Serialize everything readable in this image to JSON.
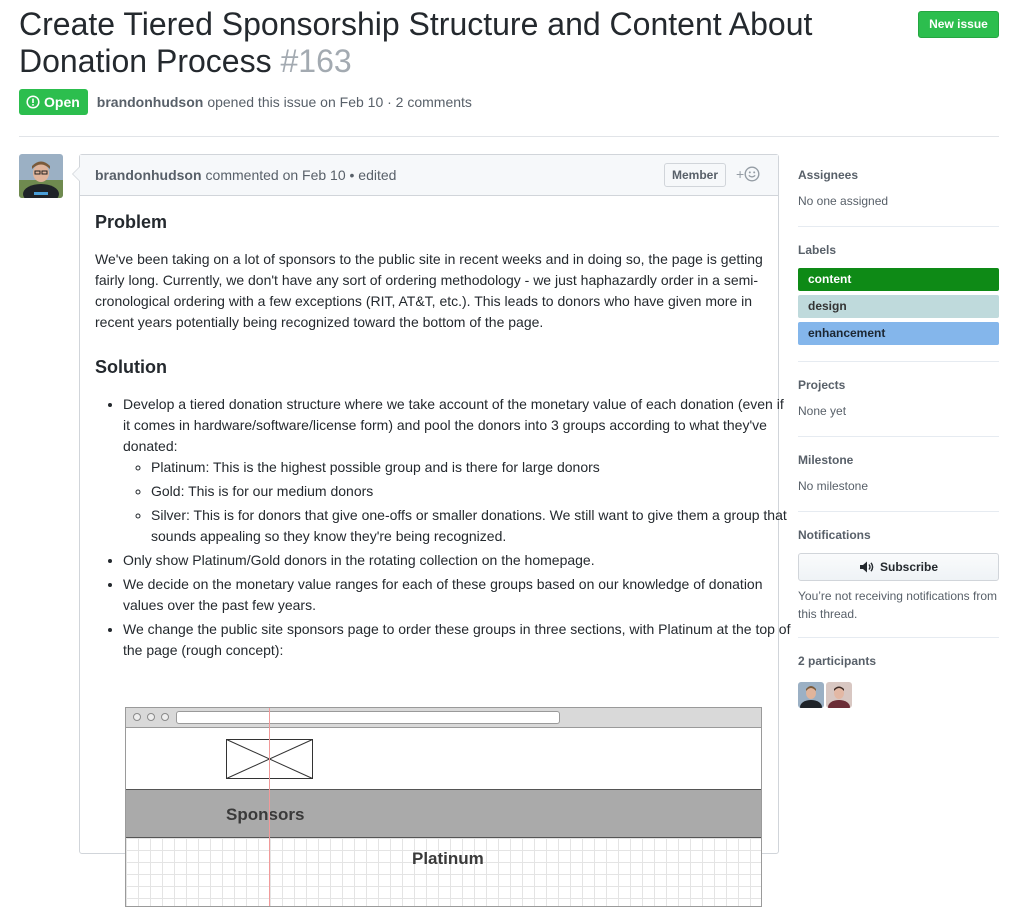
{
  "issue": {
    "title": "Create Tiered Sponsorship Structure and Content About Donation Process",
    "number": "#163",
    "state": "Open",
    "author": "brandonhudson",
    "opened_text": "opened this issue on Feb 10 · 2 comments",
    "new_issue_label": "New issue"
  },
  "comment": {
    "author": "brandonhudson",
    "meta": "commented on Feb 10 • edited",
    "role_badge": "Member",
    "reaction_label": "+",
    "problem_heading": "Problem",
    "problem_text": "We've been taking on a lot of sponsors to the public site in recent weeks and in doing so, the page is getting fairly long. Currently, we don't have any sort of ordering methodology - we just haphazardly order in a semi-cronological ordering with a few exceptions (RIT, AT&T, etc.). This leads to donors who have given more in recent years potentially being recognized toward the bottom of the page.",
    "solution_heading": "Solution",
    "bullets": {
      "b1": "Develop a tiered donation structure where we take account of the monetary value of each donation (even if it comes in hardware/software/license form) and pool the donors into 3 groups according to what they've donated:",
      "b1_sub1": "Platinum: This is the highest possible group and is there for large donors",
      "b1_sub2": "Gold: This is for our medium donors",
      "b1_sub3": "Silver: This is for donors that give one-offs or smaller donations. We still want to give them a group that sounds appealing so they know they're being recognized.",
      "b2": "Only show Platinum/Gold donors in the rotating collection on the homepage.",
      "b3": "We decide on the monetary value ranges for each of these groups based on our knowledge of donation values over the past few years.",
      "b4": "We change the public site sponsors page to order these groups in three sections, with Platinum at the top of the page (rough concept):"
    },
    "mockup": {
      "sponsors_label": "Sponsors",
      "platinum_label": "Platinum"
    }
  },
  "sidebar": {
    "assignees": {
      "heading": "Assignees",
      "value": "No one assigned"
    },
    "labels": {
      "heading": "Labels",
      "items": [
        {
          "name": "content",
          "bg": "#0e8a16",
          "fg": "#ffffff"
        },
        {
          "name": "design",
          "bg": "#bfdadc",
          "fg": "#333333"
        },
        {
          "name": "enhancement",
          "bg": "#84b6eb",
          "fg": "#1c2733"
        }
      ]
    },
    "projects": {
      "heading": "Projects",
      "value": "None yet"
    },
    "milestone": {
      "heading": "Milestone",
      "value": "No milestone"
    },
    "notifications": {
      "heading": "Notifications",
      "button": "Subscribe",
      "note": "You’re not receiving notifications from this thread."
    },
    "participants": {
      "heading": "2 participants"
    }
  },
  "colors": {
    "open_green": "#2cbe4e",
    "muted_text": "#586069",
    "border": "#d1d5da"
  }
}
